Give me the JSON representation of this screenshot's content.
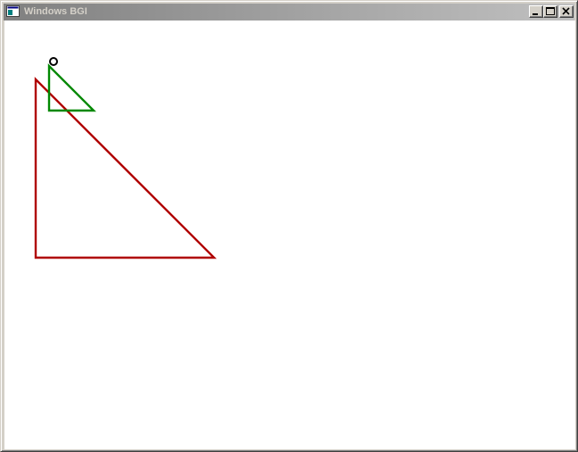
{
  "window": {
    "title": "Windows BGI",
    "app_icon": "bgi-window-icon",
    "caption_buttons": {
      "minimize": "minimize-icon",
      "maximize": "maximize-icon",
      "close": "close-icon"
    }
  },
  "canvas": {
    "background": "#ffffff",
    "shapes": [
      {
        "name": "red-right-triangle",
        "kind": "triangle",
        "color": "#b00000"
      },
      {
        "name": "green-right-triangle",
        "kind": "triangle",
        "color": "#008800"
      },
      {
        "name": "black-circle-marker",
        "kind": "circle",
        "color": "#000000"
      }
    ]
  }
}
